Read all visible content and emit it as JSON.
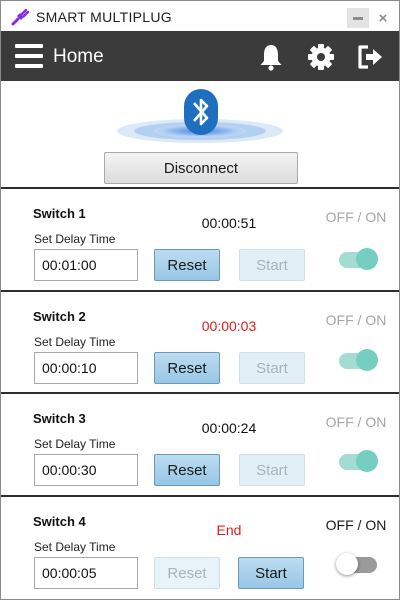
{
  "window": {
    "title": "SMART MULTIPLUG",
    "minimize_icon": "minimize-icon",
    "close_label": "×"
  },
  "header": {
    "title": "Home",
    "icons": [
      "menu-icon",
      "bell-icon",
      "gear-icon",
      "logout-icon"
    ]
  },
  "bluetooth": {
    "icon": "bluetooth-icon",
    "button_label": "Disconnect"
  },
  "labels": {
    "set_delay": "Set Delay Time",
    "off_on": "OFF / ON",
    "reset": "Reset",
    "start": "Start"
  },
  "switches": [
    {
      "name": "Switch 1",
      "timer": "00:00:51",
      "delay": "00:01:00",
      "on": true,
      "running": true
    },
    {
      "name": "Switch 2",
      "timer": "00:00:03",
      "delay": "00:00:10",
      "on": true,
      "running": true
    },
    {
      "name": "Switch 3",
      "timer": "00:00:24",
      "delay": "00:00:30",
      "on": true,
      "running": true
    },
    {
      "name": "Switch 4",
      "timer": "End",
      "delay": "00:00:05",
      "on": false,
      "running": false
    }
  ],
  "colors": {
    "header_bg": "#3b3b3b",
    "accent_blue": "#1f6fc0",
    "toggle_on": "#75cec0",
    "alert_red": "#e21b1b"
  }
}
